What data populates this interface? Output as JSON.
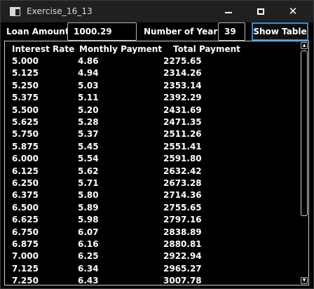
{
  "window": {
    "title": "Exercise_16_13",
    "minimize_glyph": "minimize",
    "maximize_glyph": "maximize",
    "close_glyph": "✕"
  },
  "form": {
    "loan_amount_label": "Loan Amount",
    "loan_amount_value": "1000.29",
    "years_label": "Number of Years",
    "years_value": "39",
    "show_button_label": "Show Table"
  },
  "colors": {
    "accent_border": "#2b8fd6",
    "background": "#000000",
    "text": "#ffffff"
  },
  "table": {
    "headers": [
      "Interest Rate",
      "Monthly Payment",
      "Total Payment"
    ],
    "rows": [
      [
        "5.000",
        "4.86",
        "2275.65"
      ],
      [
        "5.125",
        "4.94",
        "2314.26"
      ],
      [
        "5.250",
        "5.03",
        "2353.14"
      ],
      [
        "5.375",
        "5.11",
        "2392.29"
      ],
      [
        "5.500",
        "5.20",
        "2431.69"
      ],
      [
        "5.625",
        "5.28",
        "2471.35"
      ],
      [
        "5.750",
        "5.37",
        "2511.26"
      ],
      [
        "5.875",
        "5.45",
        "2551.41"
      ],
      [
        "6.000",
        "5.54",
        "2591.80"
      ],
      [
        "6.125",
        "5.62",
        "2632.42"
      ],
      [
        "6.250",
        "5.71",
        "2673.28"
      ],
      [
        "6.375",
        "5.80",
        "2714.36"
      ],
      [
        "6.500",
        "5.89",
        "2755.65"
      ],
      [
        "6.625",
        "5.98",
        "2797.16"
      ],
      [
        "6.750",
        "6.07",
        "2838.89"
      ],
      [
        "6.875",
        "6.16",
        "2880.81"
      ],
      [
        "7.000",
        "6.25",
        "2922.94"
      ],
      [
        "7.125",
        "6.34",
        "2965.27"
      ],
      [
        "7.250",
        "6.43",
        "3007.78"
      ]
    ]
  },
  "scrollbar": {
    "up_arrow": "▲",
    "down_arrow": "▼"
  }
}
